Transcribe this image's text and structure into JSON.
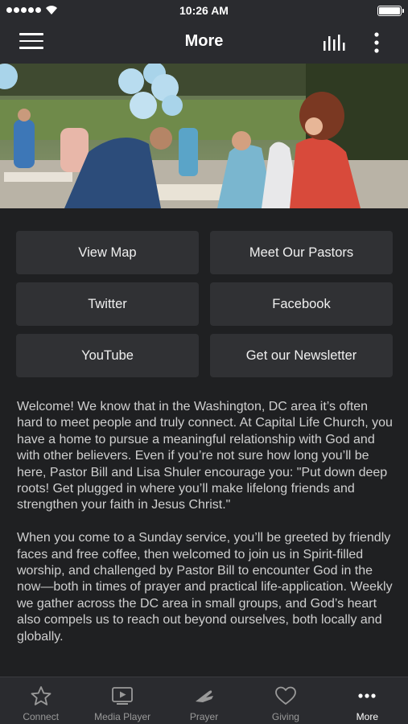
{
  "status_bar": {
    "time": "10:26 AM"
  },
  "header": {
    "title": "More"
  },
  "buttons": [
    {
      "label": "View Map"
    },
    {
      "label": "Meet Our Pastors"
    },
    {
      "label": "Twitter"
    },
    {
      "label": "Facebook"
    },
    {
      "label": "YouTube"
    },
    {
      "label": "Get our Newsletter"
    }
  ],
  "content": {
    "paragraph1": "Welcome! We know that in the Washington, DC area it’s often hard to meet people and truly connect. At Capital Life Church, you have a home to pursue a meaningful relationship with God and with other believers. Even if you’re not sure how long you’ll be here, Pastor Bill and Lisa Shuler encourage you: \"Put down deep roots! Get plugged in where you’ll make lifelong friends and strengthen your faith in Jesus Christ.\"",
    "paragraph2": "When you come to a Sunday service, you’ll be greeted by friendly faces and free coffee, then welcomed to join us in Spirit-filled worship, and challenged by Pastor Bill to encounter God in the now—both in times of prayer and practical life-application. Weekly we gather across the DC area in small groups, and God’s heart also compels us to reach out beyond ourselves, both locally and globally."
  },
  "tabs": [
    {
      "label": "Connect",
      "icon": "star-icon"
    },
    {
      "label": "Media Player",
      "icon": "media-player-icon"
    },
    {
      "label": "Prayer",
      "icon": "prayer-hands-icon"
    },
    {
      "label": "Giving",
      "icon": "heart-icon"
    },
    {
      "label": "More",
      "icon": "more-dots-icon",
      "active": true
    }
  ],
  "colors": {
    "background": "#1f2022",
    "bar": "#2a2b2f",
    "button": "#303134",
    "text": "#cfcfcf",
    "inactive_tab": "#9a9a9a"
  }
}
